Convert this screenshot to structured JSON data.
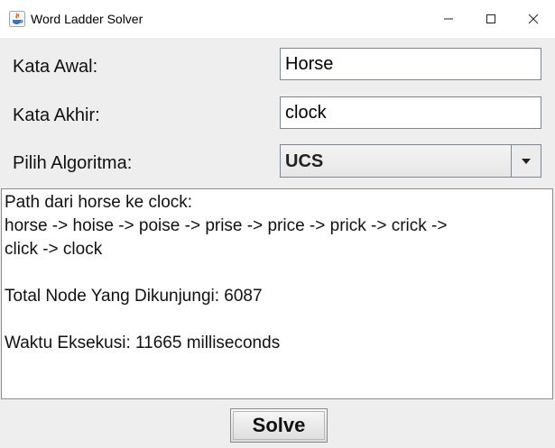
{
  "window": {
    "title": "Word Ladder Solver",
    "icon": "java-app-icon"
  },
  "form": {
    "start_label": "Kata Awal:",
    "start_value": "Horse",
    "end_label": "Kata Akhir:",
    "end_value": "clock",
    "algo_label": "Pilih Algoritma:",
    "algo_value": "UCS"
  },
  "output": {
    "line1": "Path dari horse ke clock:",
    "line2": "horse -> hoise -> poise -> prise -> price -> prick -> crick ->",
    "line3": "click -> clock",
    "line4": "Total Node Yang Dikunjungi: 6087",
    "line5": "Waktu Eksekusi: 11665 milliseconds"
  },
  "solve_label": "Solve"
}
